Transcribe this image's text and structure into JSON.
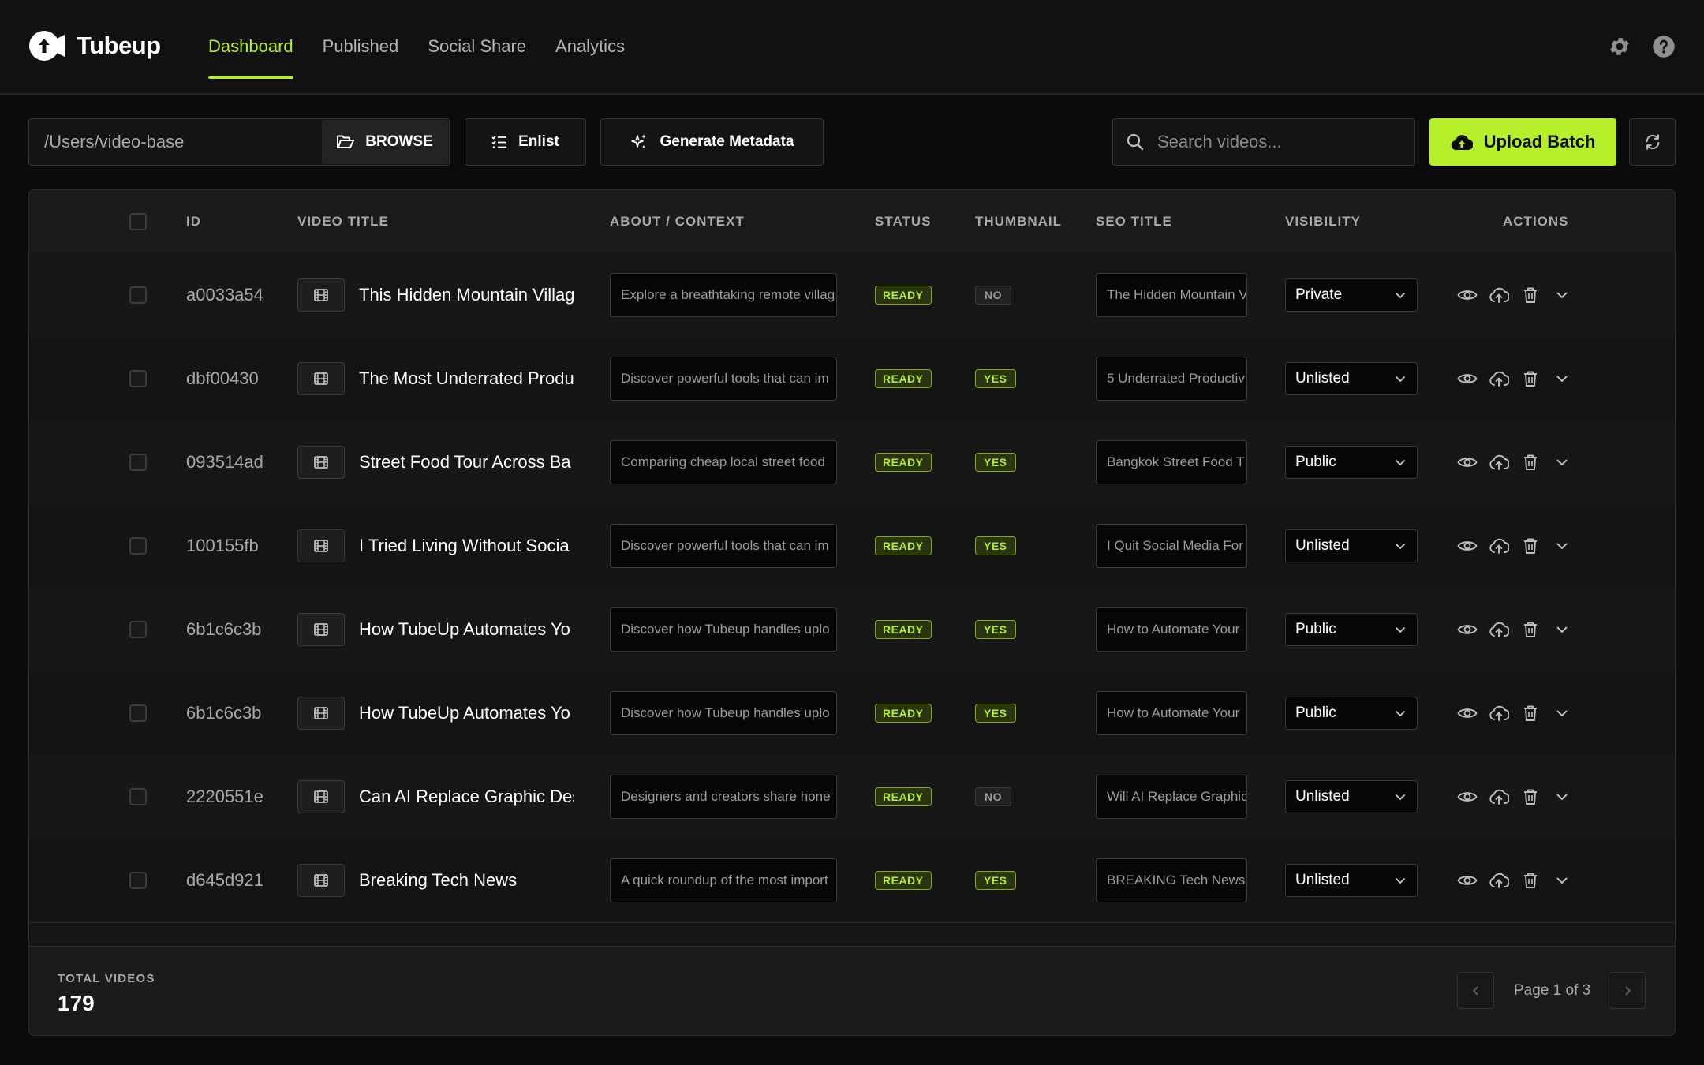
{
  "app": {
    "name": "Tubeup",
    "accent": "#b5ef2a",
    "background": "#0b0b0b"
  },
  "nav": {
    "items": [
      {
        "label": "Dashboard",
        "active": true
      },
      {
        "label": "Published",
        "active": false
      },
      {
        "label": "Social Share",
        "active": false
      },
      {
        "label": "Analytics",
        "active": false
      }
    ],
    "icons": [
      "gear-icon",
      "help-icon"
    ]
  },
  "toolbar": {
    "path_value": "/Users/video-base",
    "browse_label": "BROWSE",
    "enlist_label": "Enlist",
    "generate_label": "Generate Metadata",
    "search_placeholder": "Search videos...",
    "upload_label": "Upload Batch"
  },
  "table": {
    "headers": {
      "id": "ID",
      "video_title": "VIDEO TITLE",
      "about": "ABOUT / CONTEXT",
      "status": "STATUS",
      "thumbnail": "THUMBNAIL",
      "seo_title": "SEO TITLE",
      "visibility": "VISIBILITY",
      "actions": "ACTIONS"
    },
    "rows": [
      {
        "id": "a0033a54",
        "title": "This Hidden Mountain Villag",
        "about": "Explore a breathtaking remote villag",
        "status": "READY",
        "thumbnail": "NO",
        "seo": "The Hidden Mountain V",
        "visibility": "Private"
      },
      {
        "id": "dbf00430",
        "title": "The Most Underrated Produ",
        "about": "Discover powerful tools that can im",
        "status": "READY",
        "thumbnail": "YES",
        "seo": "5 Underrated Productiv",
        "visibility": "Unlisted"
      },
      {
        "id": "093514ad",
        "title": "Street Food Tour Across Ba",
        "about": "Comparing cheap local street food",
        "status": "READY",
        "thumbnail": "YES",
        "seo": "Bangkok Street Food T",
        "visibility": "Public"
      },
      {
        "id": "100155fb",
        "title": "I Tried Living Without Socia",
        "about": "Discover powerful tools that can im",
        "status": "READY",
        "thumbnail": "YES",
        "seo": "I Quit Social Media For",
        "visibility": "Unlisted"
      },
      {
        "id": "6b1c6c3b",
        "title": "How TubeUp Automates Yo",
        "about": "Discover how Tubeup handles uplo",
        "status": "READY",
        "thumbnail": "YES",
        "seo": "How to Automate Your",
        "visibility": "Public"
      },
      {
        "id": "6b1c6c3b",
        "title": "How TubeUp Automates Yo",
        "about": "Discover how Tubeup handles uplo",
        "status": "READY",
        "thumbnail": "YES",
        "seo": "How to Automate Your",
        "visibility": "Public"
      },
      {
        "id": "2220551e",
        "title": "Can AI Replace Graphic Des",
        "about": "Designers and creators share hone",
        "status": "READY",
        "thumbnail": "NO",
        "seo": "Will AI Replace Graphic",
        "visibility": "Unlisted"
      },
      {
        "id": "d645d921",
        "title": "Breaking Tech News",
        "about": "A quick roundup of the most import",
        "status": "READY",
        "thumbnail": "YES",
        "seo": "BREAKING Tech News:",
        "visibility": "Unlisted"
      }
    ]
  },
  "footer": {
    "total_label": "TOTAL VIDEOS",
    "total_value": "179",
    "page_text": "Page 1 of 3"
  }
}
